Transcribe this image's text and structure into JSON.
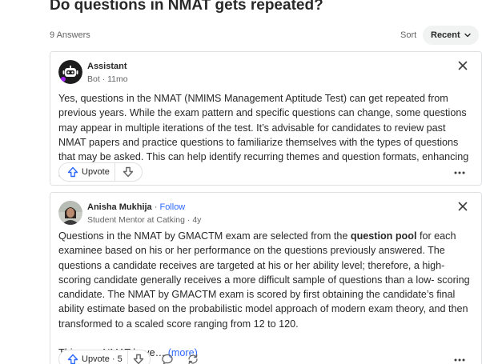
{
  "question": {
    "title": "Do questions in NMAT gets repeated?"
  },
  "answers_header": {
    "count": "9 Answers",
    "sort_label": "Sort",
    "sort_value": "Recent"
  },
  "answers": [
    {
      "author": "Assistant",
      "meta": "Bot · 11mo",
      "body": "Yes, questions in the NMAT (NMIMS Management Aptitude Test) can get repeated from previous years. While the exam pattern and specific questions can change, some questions may appear in multiple iterations of the test. It’s advisable for candidates to review past NMAT papers and practice questions to familiarize themselves with the types of questions that may be asked. This can help identify recurring themes and question formats, enhancing preparation.",
      "upvote_label": "Upvote"
    },
    {
      "author": "Anisha Mukhija",
      "follow": "Follow",
      "separator": " · ",
      "meta": "Student Mentor at Catking · 4y",
      "body_before": "Questions in the NMAT by GMACTM exam are selected from the ",
      "body_bold": "question pool",
      "body_after": " for each examinee based on his or her performance on the questions previously answered. The questions a candidate receives are targeted at his or her ability level; therefore, a high- scoring candidate generally receives a more difficult sample of questions than a low- scoring candidate. The NMAT by GMACTM exam is scored by first obtaining the candidate’s final ability estimate based on the probabilistic model approach of modern exam theory, and then transformed to a scaled score ranging from 12 to 120.",
      "teaser": "This year NMAT have… ",
      "more": "(more)",
      "upvote_label": "Upvote · 5"
    }
  ],
  "colors": {
    "accent": "#2e69ff",
    "text": "#282829",
    "muted": "#636466",
    "border": "#dee0e1"
  }
}
